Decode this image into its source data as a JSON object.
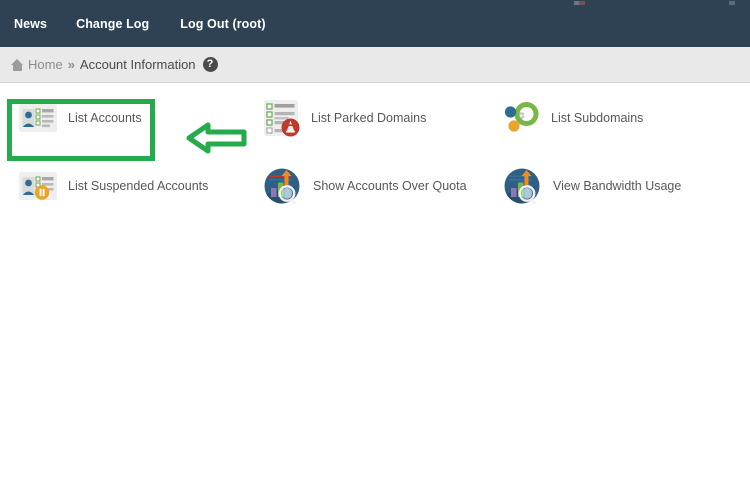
{
  "topbar": {
    "nav": [
      {
        "label": "News",
        "name": "nav-news"
      },
      {
        "label": "Change Log",
        "name": "nav-change-log"
      },
      {
        "label": "Log Out (root)",
        "name": "nav-log-out"
      }
    ]
  },
  "breadcrumb": {
    "home_label": "Home",
    "separator": "»",
    "current_label": "Account Information",
    "help_glyph": "?",
    "home_icon": "home-icon",
    "help_icon": "help-circle-icon"
  },
  "annotations": {
    "highlight_color": "#25ab4b",
    "arrow_color": "#25ab4b",
    "arrow_direction": "left",
    "highlight_target": "List Accounts"
  },
  "colors": {
    "topbar_bg": "#2e4254",
    "breadcrumb_bg": "#e9e9e9",
    "body_bg": "#ffffff",
    "label_text": "#575757",
    "accent_green": "#25ab4b"
  },
  "main": {
    "items": [
      {
        "label": "List Accounts",
        "icon": "account-card-icon",
        "row": 0,
        "col": 0
      },
      {
        "label": "List Parked Domains",
        "icon": "parked-domains-icon",
        "row": 0,
        "col": 1
      },
      {
        "label": "List Subdomains",
        "icon": "subdomains-nodes-icon",
        "row": 0,
        "col": 2
      },
      {
        "label": "List Suspended Accounts",
        "icon": "suspended-account-icon",
        "row": 1,
        "col": 0
      },
      {
        "label": "Show Accounts Over Quota",
        "icon": "over-quota-chart-icon",
        "row": 1,
        "col": 1
      },
      {
        "label": "View Bandwidth Usage",
        "icon": "bandwidth-usage-icon",
        "row": 1,
        "col": 2
      }
    ]
  }
}
